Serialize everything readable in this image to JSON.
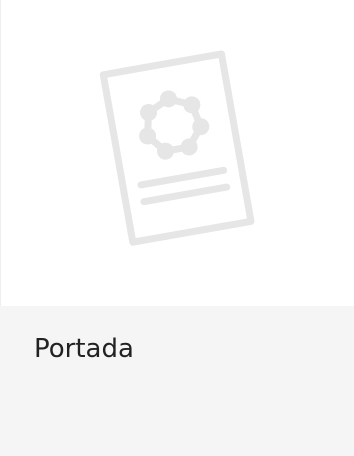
{
  "card": {
    "thumbnail_icon": "document-placeholder-icon",
    "title": "Portada",
    "colors": {
      "thumbnail_background": "#ffffff",
      "footer_background": "#f5f5f5",
      "icon_stroke": "#e6e6e6",
      "title_text": "#222222"
    }
  }
}
